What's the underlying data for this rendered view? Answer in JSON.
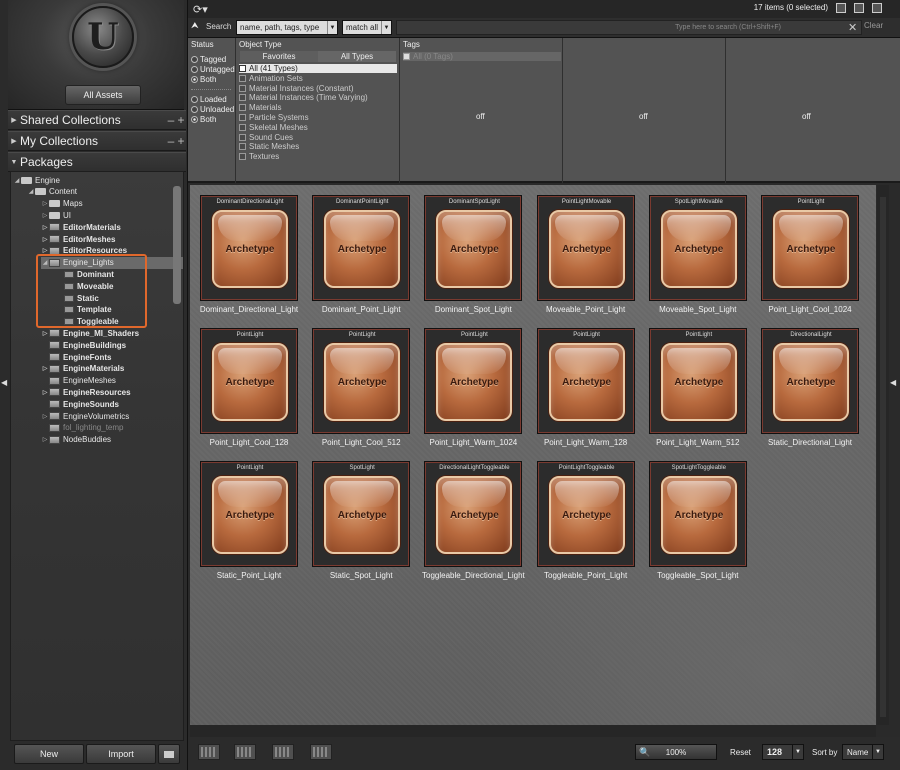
{
  "left_panel": {
    "all_assets_label": "All Assets",
    "shared_collections": "Shared Collections",
    "my_collections": "My Collections",
    "packages": "Packages",
    "tree": [
      {
        "label": "Engine",
        "kind": "folder",
        "expander": "open",
        "bold": false,
        "dim": false
      },
      {
        "label": "Content",
        "kind": "folder",
        "expander": "open",
        "bold": false,
        "dim": false
      },
      {
        "label": "Maps",
        "kind": "folder",
        "expander": "closed",
        "bold": false,
        "dim": false
      },
      {
        "label": "UI",
        "kind": "folder",
        "expander": "closed",
        "bold": false,
        "dim": false
      },
      {
        "label": "EditorMaterials",
        "kind": "package",
        "expander": "closed",
        "bold": true,
        "dim": false
      },
      {
        "label": "EditorMeshes",
        "kind": "package",
        "expander": "closed",
        "bold": true,
        "dim": false
      },
      {
        "label": "EditorResources",
        "kind": "package",
        "expander": "closed",
        "bold": true,
        "dim": false
      },
      {
        "label": "Engine_Lights",
        "kind": "package",
        "expander": "open",
        "bold": false,
        "dim": false,
        "selected": true
      },
      {
        "label": "Dominant",
        "kind": "sub",
        "expander": "",
        "bold": true,
        "dim": false
      },
      {
        "label": "Moveable",
        "kind": "sub",
        "expander": "",
        "bold": true,
        "dim": false
      },
      {
        "label": "Static",
        "kind": "sub",
        "expander": "",
        "bold": true,
        "dim": false
      },
      {
        "label": "Template",
        "kind": "sub",
        "expander": "",
        "bold": true,
        "dim": false
      },
      {
        "label": "Toggleable",
        "kind": "sub",
        "expander": "",
        "bold": true,
        "dim": false
      },
      {
        "label": "Engine_MI_Shaders",
        "kind": "package",
        "expander": "closed",
        "bold": true,
        "dim": false
      },
      {
        "label": "EngineBuildings",
        "kind": "package",
        "expander": "",
        "bold": true,
        "dim": false
      },
      {
        "label": "EngineFonts",
        "kind": "package",
        "expander": "",
        "bold": true,
        "dim": false
      },
      {
        "label": "EngineMaterials",
        "kind": "package",
        "expander": "closed",
        "bold": true,
        "dim": false
      },
      {
        "label": "EngineMeshes",
        "kind": "package",
        "expander": "",
        "bold": false,
        "dim": false
      },
      {
        "label": "EngineResources",
        "kind": "package",
        "expander": "closed",
        "bold": true,
        "dim": false
      },
      {
        "label": "EngineSounds",
        "kind": "package",
        "expander": "",
        "bold": true,
        "dim": false
      },
      {
        "label": "EngineVolumetrics",
        "kind": "package",
        "expander": "closed",
        "bold": false,
        "dim": false
      },
      {
        "label": "fol_lighting_temp",
        "kind": "package",
        "expander": "",
        "bold": false,
        "dim": true
      },
      {
        "label": "NodeBuddies",
        "kind": "package",
        "expander": "closed",
        "bold": false,
        "dim": false
      }
    ],
    "new_label": "New",
    "import_label": "Import"
  },
  "top_bar": {
    "item_count": "17 items (0 selected)"
  },
  "search": {
    "label": "Search",
    "field_combo": "name, path, tags, type",
    "match_combo": "match all",
    "placeholder": "Type here to search  (Ctrl+Shift+F)",
    "clear_label": "Clear"
  },
  "filters": {
    "status_header": "Status",
    "status_group1": [
      {
        "label": "Tagged",
        "on": false
      },
      {
        "label": "Untagged",
        "on": false
      },
      {
        "label": "Both",
        "on": true
      }
    ],
    "status_group2": [
      {
        "label": "Loaded",
        "on": false
      },
      {
        "label": "Unloaded",
        "on": false
      },
      {
        "label": "Both",
        "on": true
      }
    ],
    "object_type_header": "Object Type",
    "tab_favorites": "Favorites",
    "tab_all_types": "All Types",
    "object_types": [
      {
        "label": "All  (41 Types)",
        "checked": true
      },
      {
        "label": "Animation Sets",
        "checked": false
      },
      {
        "label": "Material Instances (Constant)",
        "checked": false
      },
      {
        "label": "Material Instances (Time Varying)",
        "checked": false
      },
      {
        "label": "Materials",
        "checked": false
      },
      {
        "label": "Particle Systems",
        "checked": false
      },
      {
        "label": "Skeletal Meshes",
        "checked": false
      },
      {
        "label": "Sound Cues",
        "checked": false
      },
      {
        "label": "Static Meshes",
        "checked": false
      },
      {
        "label": "Textures",
        "checked": false
      }
    ],
    "tags_header": "Tags",
    "tags_all": "All  (0 Tags)",
    "off_labels": [
      "off",
      "off",
      "off"
    ]
  },
  "assets": [
    {
      "type": "DominantDirectionalLight",
      "thumb": "Archetype",
      "name": "Dominant_Directional_Light"
    },
    {
      "type": "DominantPointLight",
      "thumb": "Archetype",
      "name": "Dominant_Point_Light"
    },
    {
      "type": "DominantSpotLight",
      "thumb": "Archetype",
      "name": "Dominant_Spot_Light"
    },
    {
      "type": "PointLightMovable",
      "thumb": "Archetype",
      "name": "Moveable_Point_Light"
    },
    {
      "type": "SpotLightMovable",
      "thumb": "Archetype",
      "name": "Moveable_Spot_Light"
    },
    {
      "type": "PointLight",
      "thumb": "Archetype",
      "name": "Point_Light_Cool_1024"
    },
    {
      "type": "PointLight",
      "thumb": "Archetype",
      "name": "Point_Light_Cool_128"
    },
    {
      "type": "PointLight",
      "thumb": "Archetype",
      "name": "Point_Light_Cool_512"
    },
    {
      "type": "PointLight",
      "thumb": "Archetype",
      "name": "Point_Light_Warm_1024"
    },
    {
      "type": "PointLight",
      "thumb": "Archetype",
      "name": "Point_Light_Warm_128"
    },
    {
      "type": "PointLight",
      "thumb": "Archetype",
      "name": "Point_Light_Warm_512"
    },
    {
      "type": "DirectionalLight",
      "thumb": "Archetype",
      "name": "Static_Directional_Light"
    },
    {
      "type": "PointLight",
      "thumb": "Archetype",
      "name": "Static_Point_Light"
    },
    {
      "type": "SpotLight",
      "thumb": "Archetype",
      "name": "Static_Spot_Light"
    },
    {
      "type": "DirectionalLightToggleable",
      "thumb": "Archetype",
      "name": "Toggleable_Directional_Light"
    },
    {
      "type": "PointLightToggleable",
      "thumb": "Archetype",
      "name": "Toggleable_Point_Light"
    },
    {
      "type": "SpotLightToggleable",
      "thumb": "Archetype",
      "name": "Toggleable_Spot_Light"
    }
  ],
  "bottom_bar": {
    "zoom": "100%",
    "reset_label": "Reset",
    "thumb_size": "128",
    "sort_by_label": "Sort by",
    "sort_value": "Name"
  },
  "colors": {
    "highlight": "#e0682c",
    "thumb_orange": "#b86a3e"
  }
}
